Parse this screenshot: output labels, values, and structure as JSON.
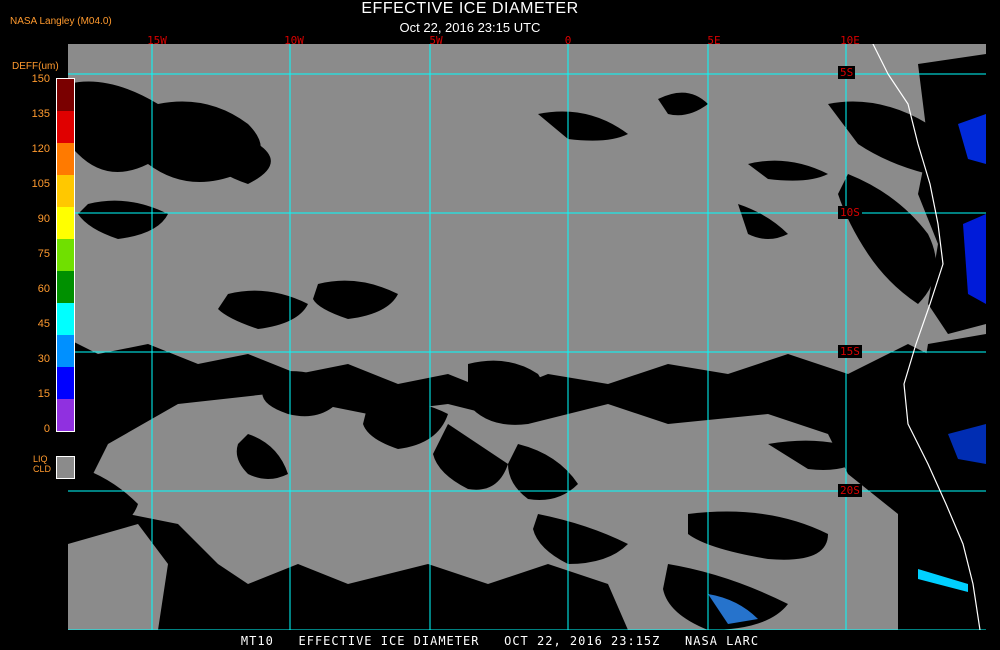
{
  "header": {
    "producer": "NASA Langley (M04.0)",
    "title": "EFFECTIVE ICE DIAMETER",
    "subtitle": "Oct 22, 2016 23:15 UTC"
  },
  "colorbar": {
    "unit_label": "DEFF(um)",
    "ticks": [
      "150",
      "135",
      "120",
      "105",
      "90",
      "75",
      "60",
      "45",
      "30",
      "15",
      "0"
    ],
    "colors": [
      "#7a0000",
      "#e00000",
      "#ff7a00",
      "#ffc800",
      "#ffff00",
      "#70e000",
      "#009000",
      "#00ffff",
      "#0090ff",
      "#0000ff",
      "#9030e0"
    ],
    "liquid_label_1": "LIQ",
    "liquid_label_2": "CLD",
    "liquid_color": "#8b8b8b"
  },
  "map": {
    "longitude_labels": [
      "15W",
      "10W",
      "5W",
      "0",
      "5E",
      "10E"
    ],
    "latitude_labels": [
      "5S",
      "10S",
      "15S",
      "20S"
    ],
    "grid_color": "#00ffff",
    "cloud_color": "#8b8b8b",
    "coast_color": "#ffffff"
  },
  "footer": {
    "text": "MT10   EFFECTIVE ICE DIAMETER   OCT 22, 2016 23:15Z   NASA LARC"
  }
}
